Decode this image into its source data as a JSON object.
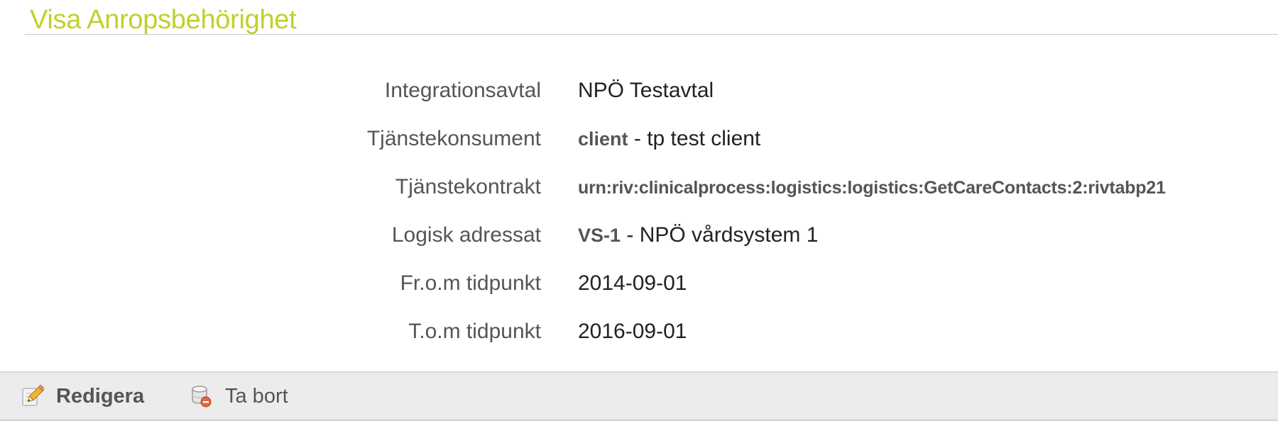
{
  "header": {
    "title": "Visa Anropsbehörighet"
  },
  "properties": [
    {
      "label": "Integrationsavtal",
      "value": "NPÖ Testavtal"
    },
    {
      "label": "Tjänstekonsument",
      "value_bold": "client",
      "value": " - tp test client"
    },
    {
      "label": "Tjänstekontrakt",
      "value_bold": "urn:riv:clinicalprocess:logistics:logistics:GetCareContacts:2:rivtabp21"
    },
    {
      "label": "Logisk adressat",
      "value_bold": "VS-1",
      "value": " - NPÖ vårdsystem 1"
    },
    {
      "label": "Fr.o.m tidpunkt",
      "value": "2014-09-01"
    },
    {
      "label": "T.o.m tidpunkt",
      "value": "2016-09-01"
    }
  ],
  "buttons": {
    "edit": {
      "label": "Redigera",
      "icon": "pencil-icon"
    },
    "delete": {
      "label": "Ta bort",
      "icon": "database-delete-icon"
    }
  },
  "colors": {
    "title": "#c3cf2c",
    "button_bar": "#ececec"
  }
}
